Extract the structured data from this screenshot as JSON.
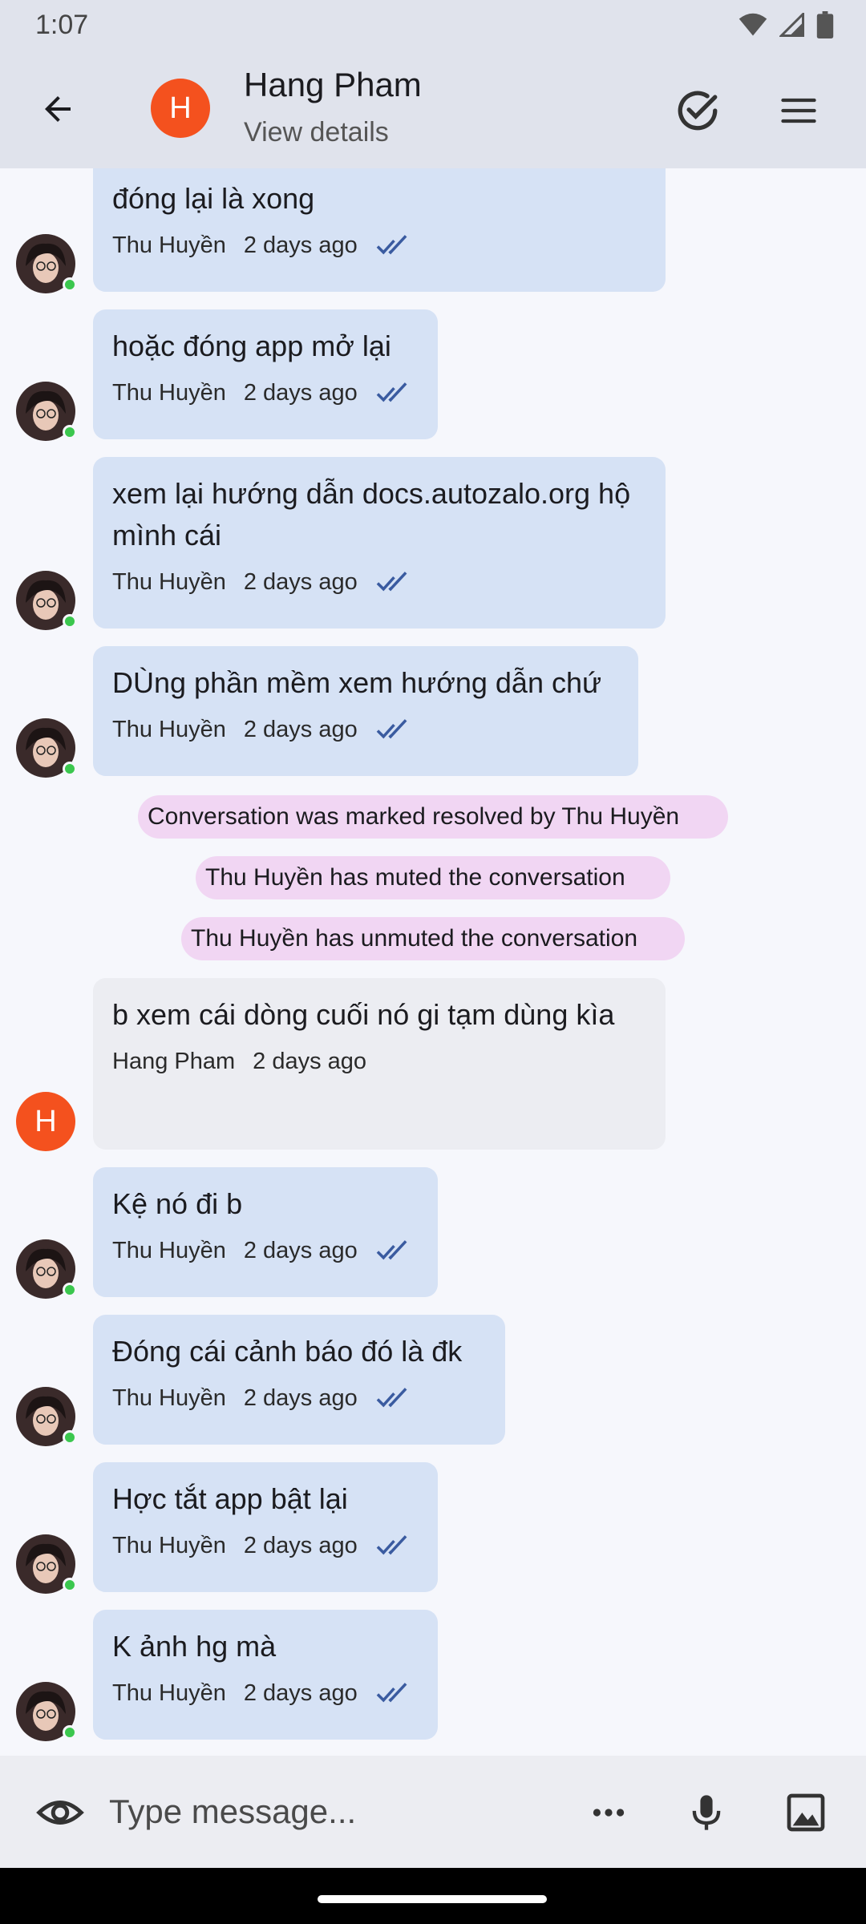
{
  "status_bar": {
    "time": "1:07"
  },
  "header": {
    "avatar_initial": "H",
    "name": "Hang Pham",
    "subtitle": "View details"
  },
  "messages": [
    {
      "text": "đóng lại là xong",
      "author": "Thu Huyền",
      "time": "2 days ago"
    },
    {
      "text": "hoặc đóng app mở lại",
      "author": "Thu Huyền",
      "time": "2 days ago"
    },
    {
      "text": "xem lại hướng dẫn docs.autozalo.org hộ mình cái",
      "author": "Thu Huyền",
      "time": "2 days ago"
    },
    {
      "text": "DÙng phần mềm xem hướng dẫn chứ",
      "author": "Thu Huyền",
      "time": "2 days ago"
    },
    {
      "text": "b xem cái dòng cuối nó gi tạm dùng kìa",
      "author": "Hang Pham",
      "time": "2 days ago"
    },
    {
      "text": "Kệ nó đi b",
      "author": "Thu Huyền",
      "time": "2 days ago"
    },
    {
      "text": "Đóng cái cảnh báo đó là đk",
      "author": "Thu Huyền",
      "time": "2 days ago"
    },
    {
      "text": "Hợc tắt app bật lại",
      "author": "Thu Huyền",
      "time": "2 days ago"
    },
    {
      "text": "K ảnh hg mà",
      "author": "Thu Huyền",
      "time": "2 days ago"
    }
  ],
  "system_events": [
    "Conversation was marked resolved by Thu Huyền",
    "Thu Huyền has muted the conversation",
    "Thu Huyền has unmuted the conversation"
  ],
  "composer": {
    "placeholder": "Type message..."
  },
  "colors": {
    "outgoing_bubble": "#D6E2F5",
    "incoming_bubble": "#ECEDF2",
    "system_pill": "#F1D6F3",
    "avatar_orange": "#F4511E",
    "online_green": "#3BC74E",
    "tick_blue": "#3A5BA0"
  }
}
